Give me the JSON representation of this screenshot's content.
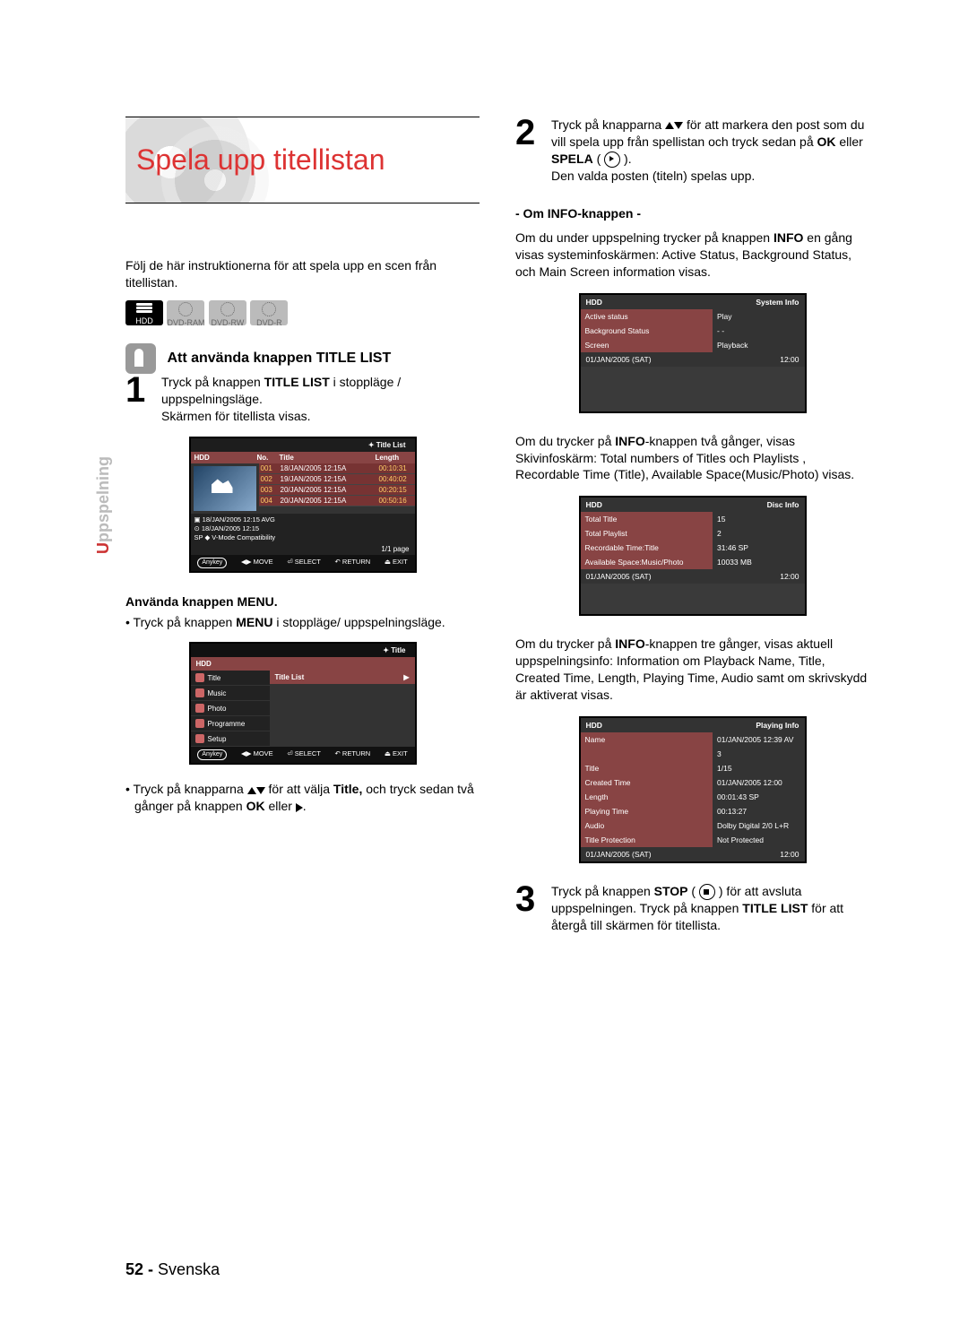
{
  "sideTab": {
    "accent": "U",
    "rest": "ppspelning"
  },
  "title": "Spela upp titellistan",
  "intro": "Följ de här instruktionerna för att spela upp en scen från titellistan.",
  "mediaIcons": [
    "HDD",
    "DVD-RAM",
    "DVD-RW",
    "DVD-R"
  ],
  "sectionTitleList": "Att använda knappen TITLE LIST",
  "step1": {
    "pre": "Tryck på knappen ",
    "b": "TITLE LIST",
    "post": " i stoppläge / uppspelningsläge.",
    "line2": "Skärmen för titellista visas."
  },
  "titleListOsd": {
    "top": "✦  Title List",
    "hdd": "HDD",
    "cols": [
      "",
      "No.",
      "Title",
      "Length"
    ],
    "rows": [
      {
        "no": "001",
        "title": "18/JAN/2005 12:15A",
        "len": "00:10:31"
      },
      {
        "no": "002",
        "title": "19/JAN/2005 12:15A",
        "len": "00:40:02"
      },
      {
        "no": "003",
        "title": "20/JAN/2005 12:15A",
        "len": "00:20:15"
      },
      {
        "no": "004",
        "title": "20/JAN/2005 12:15A",
        "len": "00:50:16"
      }
    ],
    "info": [
      "▣ 18/JAN/2005 12:15 AVG",
      "⊙ 18/JAN/2005 12:15",
      "SP ◆ V-Mode Compatibility"
    ],
    "page": "1/1 page",
    "foot": [
      "Anykey",
      "◀▶ MOVE",
      "⏎ SELECT",
      "↶ RETURN",
      "⏏ EXIT"
    ]
  },
  "subMenu": "Använda knappen MENU.",
  "menuBullet": {
    "pre": "Tryck på knappen ",
    "b": "MENU",
    "post": " i stoppläge/ uppspelningsläge."
  },
  "menuOsd": {
    "top": "✦  Title",
    "bar": "HDD",
    "items": [
      "Title",
      "Music",
      "Photo",
      "Programme",
      "Setup"
    ],
    "sel": "Title List",
    "foot": [
      "Anykey",
      "◀▶ MOVE",
      "⏎ SELECT",
      "↶ RETURN",
      "⏏ EXIT"
    ]
  },
  "navBullet": {
    "pre": "Tryck på knapparna ",
    "mid": " för att välja ",
    "b": "Title,",
    "post": " och tryck sedan två gånger på knappen ",
    "b2": "OK",
    "post2": " eller "
  },
  "step2": {
    "pre": "Tryck på knapparna ",
    "mid": " för att markera den post som du vill spela upp från spellistan och tryck sedan på ",
    "b1": "OK",
    "or": " eller ",
    "b2": "SPELA",
    "post": " ( ",
    "line2": "Den valda posten (titeln) spelas upp."
  },
  "infoH": "- Om INFO-knappen -",
  "infoP1": {
    "pre": "Om du under uppspelning trycker på knappen ",
    "b": "INFO",
    "post": " en gång visas systeminfoskärmen: Active Status, Background Status, och Main Screen information visas."
  },
  "osd1": {
    "title": "HDD",
    "right": "System Info",
    "rows": [
      {
        "l": "Active status",
        "r": "Play"
      },
      {
        "l": "Background Status",
        "r": "- -"
      },
      {
        "l": "Screen",
        "r": "Playback"
      }
    ],
    "footL": "01/JAN/2005 (SAT)",
    "footR": "12:00"
  },
  "infoP2": {
    "pre": "Om du trycker på ",
    "b": "INFO",
    "post": "-knappen två gånger, visas Skivinfoskärm: Total numbers of Titles och Playlists , Recordable Time (Title), Available Space(Music/Photo)  visas."
  },
  "osd2": {
    "title": "HDD",
    "right": "Disc Info",
    "rows": [
      {
        "l": "Total Title",
        "r": "15"
      },
      {
        "l": "Total Playlist",
        "r": "2"
      },
      {
        "l": "Recordable Time:Title",
        "r": "31:46  SP"
      },
      {
        "l": "Available Space:Music/Photo",
        "r": "10033 MB"
      }
    ],
    "footL": "01/JAN/2005 (SAT)",
    "footR": "12:00"
  },
  "infoP3": {
    "pre": "Om du trycker på ",
    "b": "INFO",
    "post": "-knappen tre gånger, visas aktuell uppspelningsinfo: Information om Playback Name, Title, Created Time, Length, Playing Time, Audio samt om skrivskydd är aktiverat visas."
  },
  "osd3": {
    "title": "HDD",
    "right": "Playing Info",
    "rows": [
      {
        "l": "Name",
        "r": "01/JAN/2005 12:39 AV"
      },
      {
        "l": "",
        "r": "3"
      },
      {
        "l": "Title",
        "r": "1/15"
      },
      {
        "l": "Created Time",
        "r": "01/JAN/2005 12:00"
      },
      {
        "l": "Length",
        "r": "00:01:43 SP"
      },
      {
        "l": "Playing Time",
        "r": "00:13:27"
      },
      {
        "l": "Audio",
        "r": "Dolby Digital 2/0 L+R"
      },
      {
        "l": "Title Protection",
        "r": "Not Protected"
      }
    ],
    "footL": "01/JAN/2005 (SAT)",
    "footR": "12:00"
  },
  "step3": {
    "pre": "Tryck på knappen ",
    "b": "STOP",
    "post": " ( ",
    "mid": " ) för att avsluta uppspelningen. Tryck på knappen ",
    "b2": "TITLE LIST",
    "post2": " för att återgå till skärmen för titellista."
  },
  "footer": {
    "num": "52 -",
    "lang": "Svenska"
  }
}
